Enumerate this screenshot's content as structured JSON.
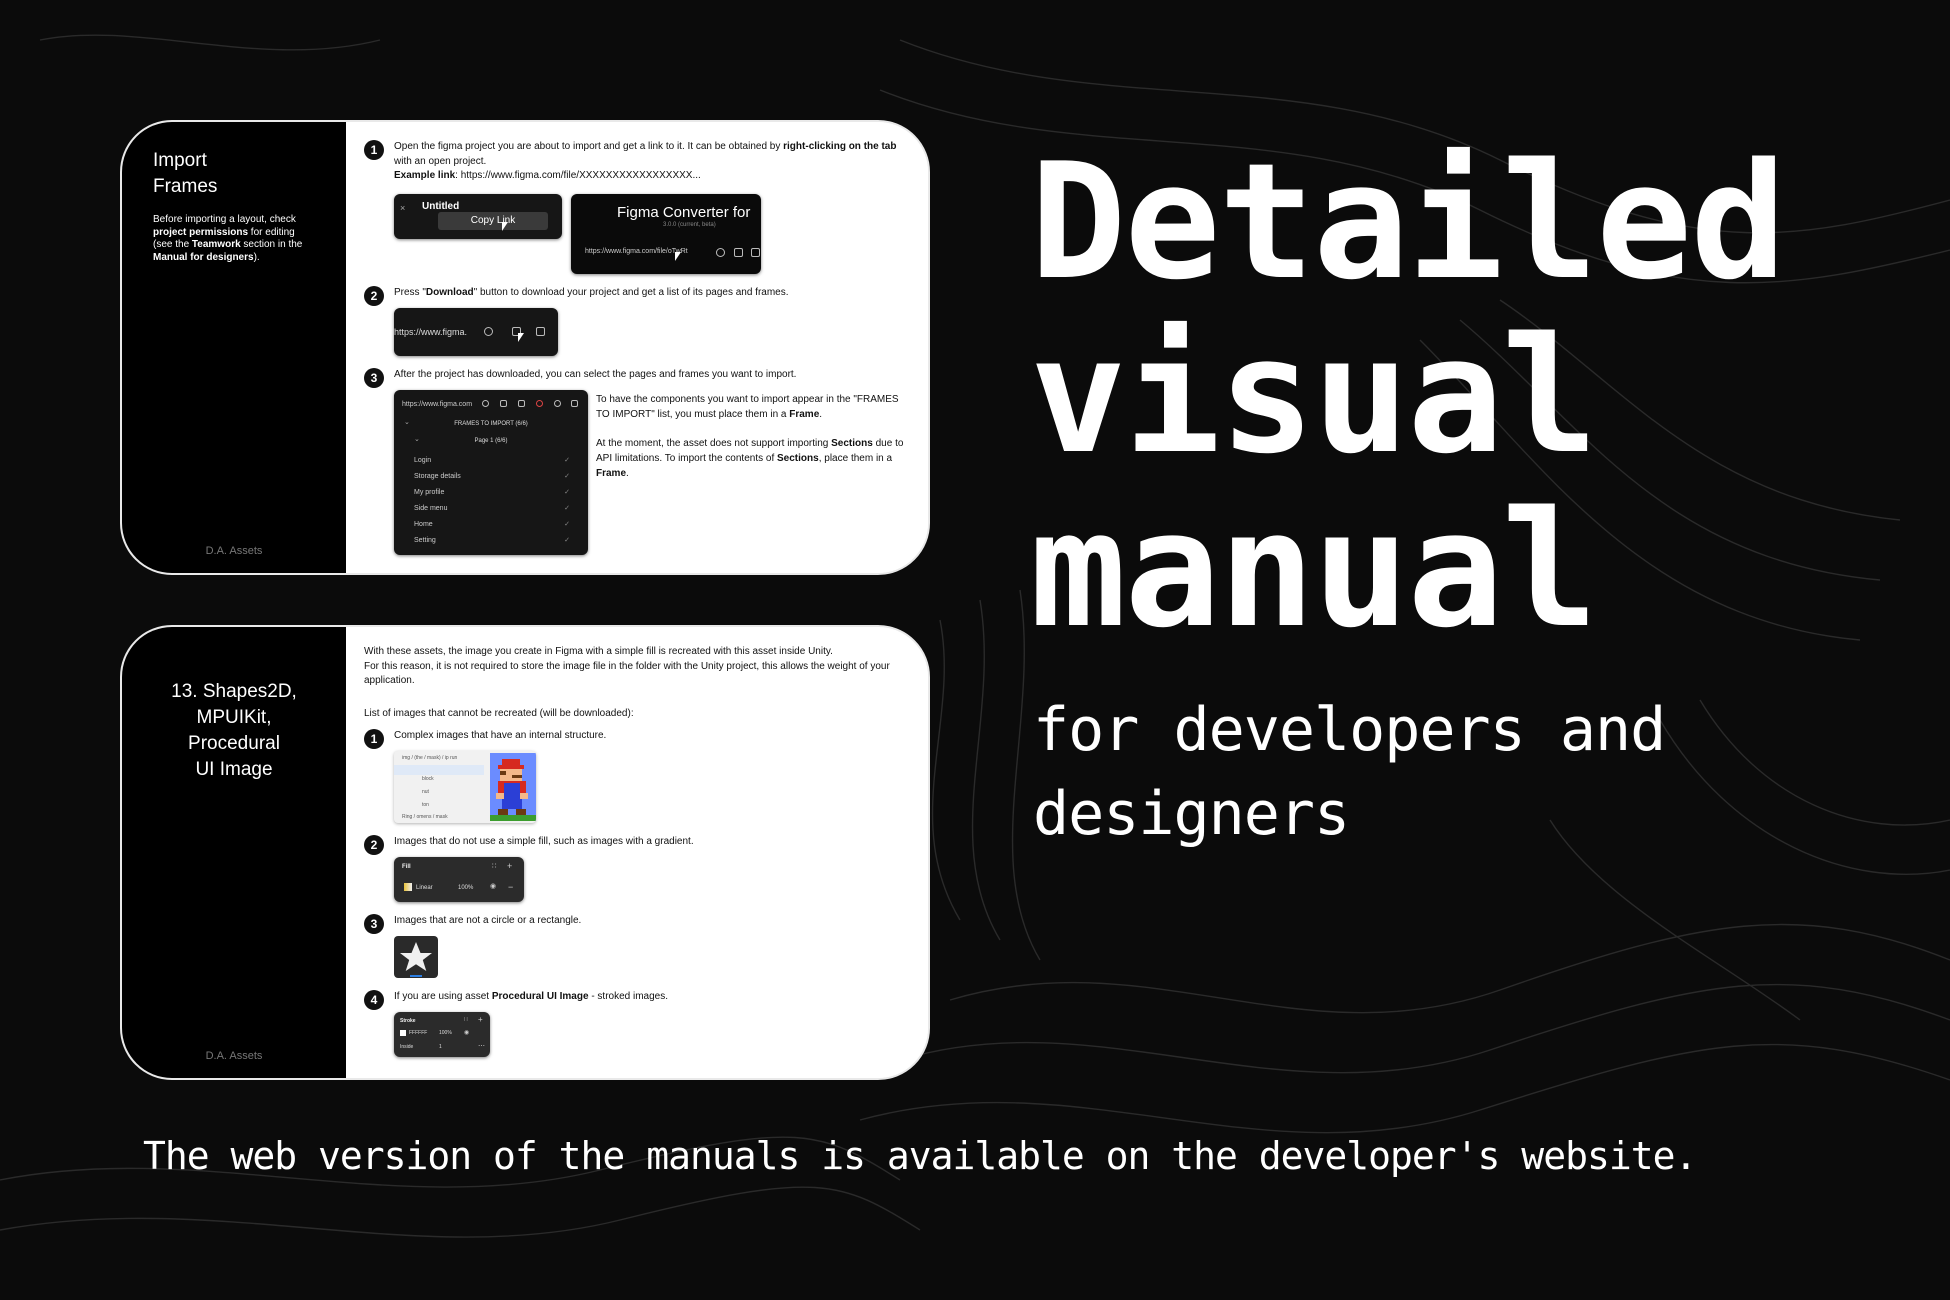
{
  "colors": {
    "background": "#0b0b0b",
    "card_border": "#e9e9e9",
    "sidebar": "#000000",
    "accent_link": "#00aaff"
  },
  "card1": {
    "title_line1": "Import",
    "title_line2": "Frames",
    "note_before": "Before importing a layout, check",
    "note_permissions": "project permissions",
    "note_for_editing": " for editing",
    "note_see": "(see the ",
    "note_teamwork": "Teamwork",
    "note_section": " section in the",
    "note_manual": "Manual for designers",
    "note_end": ").",
    "footer": "D.A. Assets",
    "step1_text": "Open the figma project you are about to import and get a link to it. It can be obtained by ",
    "step1_bold": "right-clicking on the tab",
    "step1_text2": "with an open project.",
    "example_label": "Example link",
    "example_value": ": https://www.figma.com/file/XXXXXXXXXXXXXXXXX...",
    "tab_label": "Untitled",
    "copy_link": "Copy Link",
    "converter_title": "Figma Converter for",
    "converter_version": "3.0.0 (current, beta)",
    "converter_url": "https://www.figma.com/file/oTwRt",
    "step2_pre": "Press \"",
    "step2_bold": "Download",
    "step2_post": "\" button to download your project and get a list of its pages and frames.",
    "step2_url": "https://www.figma.",
    "step3_text": "After the project has downloaded, you can select the pages and frames you want to import.",
    "panel_url": "https://www.figma.com",
    "frames_header": "FRAMES TO IMPORT (6/6)",
    "page_header": "Page 1 (6/6)",
    "frames": [
      "Login",
      "Storage details",
      "My profile",
      "Side menu",
      "Home",
      "Setting"
    ],
    "note1_a": "To have the components you want to import appear in the \"FRAMES TO IMPORT\" list, you must place them in a ",
    "note1_b": "Frame",
    "note1_c": ".",
    "note2_a": "At the moment, the asset does not support importing ",
    "note2_b": "Sections",
    "note2_c": " due to API limitations. To import the contents of ",
    "note2_d": "Sections",
    "note2_e": ", place them in a ",
    "note2_f": "Frame",
    "note2_g": "."
  },
  "card2": {
    "title_lines": [
      "13. Shapes2D,",
      "MPUIKit,",
      "Procedural",
      "UI Image"
    ],
    "footer": "D.A. Assets",
    "intro1": "With these assets, the image you create in Figma with a simple fill is recreated with this asset inside Unity.",
    "intro2": "For this reason, it is not required to store the image file in the folder with the Unity project, this allows the weight of your application.",
    "list_title": "List of images that cannot be recreated (will be downloaded):",
    "item1": "Complex images that have an internal structure.",
    "item2": "Images that do not use a simple fill, such as images with a gradient.",
    "item3": "Images that are not a circle or a rectangle.",
    "item4_a": "If you are using asset ",
    "item4_b": "Procedural UI Image",
    "item4_c": " - stroked images.",
    "layers": [
      "img / (the / mask) / ip run",
      "block",
      "nut",
      "ton",
      "Ring / omens / mask"
    ],
    "fill_label": "Fill",
    "fill_type": "Linear",
    "fill_pct": "100%",
    "stroke_label": "Stroke",
    "stroke_color": "FFFFFF",
    "stroke_pct": "100%",
    "stroke_pos": "Inside",
    "stroke_width": "1"
  },
  "headline": [
    "Detailed",
    "visual",
    "manual"
  ],
  "subhead": "for developers and designers",
  "bottom_text": "The web version of the manuals is available on the developer's website."
}
